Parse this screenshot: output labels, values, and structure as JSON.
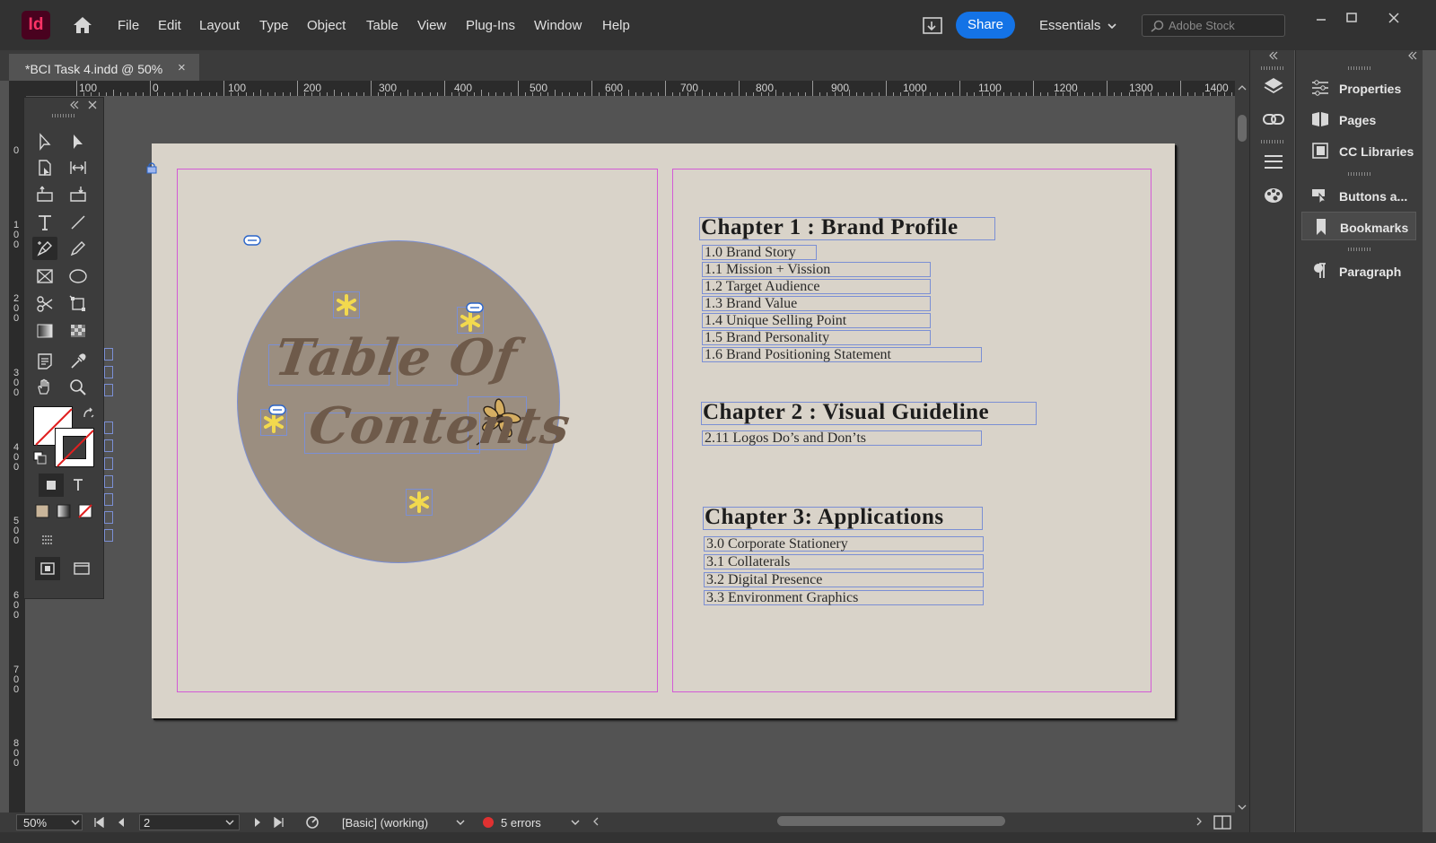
{
  "app": {
    "logo_text": "Id"
  },
  "menu": [
    "File",
    "Edit",
    "Layout",
    "Type",
    "Object",
    "Table",
    "View",
    "Plug-Ins",
    "Window",
    "Help"
  ],
  "toolbar": {
    "share_label": "Share",
    "workspace_label": "Essentials",
    "stock_placeholder": "Adobe Stock"
  },
  "document": {
    "tab_label": "*BCI Task 4.indd @ 50%",
    "tab_close": "×"
  },
  "ruler": {
    "h_labels": [
      "100",
      "0",
      "100",
      "200",
      "300",
      "400",
      "500",
      "600",
      "700",
      "800",
      "900",
      "1000",
      "1100",
      "1200",
      "1300",
      "1400"
    ],
    "v_labels": [
      "0",
      "100",
      "200",
      "300",
      "400",
      "500",
      "600",
      "700",
      "800"
    ]
  },
  "page": {
    "left": {
      "title_line1": "Table Of",
      "title_line2": "Contents"
    },
    "chapters": [
      {
        "title": "Chapter 1 : Brand Profile",
        "items": [
          "1.0 Brand Story",
          "1.1 Mission + Vission",
          "1.2 Target Audience",
          "1.3 Brand Value",
          "1.4 Unique Selling Point",
          "1.5 Brand Personality",
          "1.6 Brand Positioning Statement"
        ]
      },
      {
        "title": "Chapter 2 : Visual Guideline",
        "items": [
          "2.11 Logos Do’s and Don’ts"
        ]
      },
      {
        "title": "Chapter 3: Applications",
        "items": [
          "3.0 Corporate Stationery",
          "3.1 Collaterals",
          "3.2 Digital Presence",
          "3.3 Environment Graphics"
        ]
      }
    ]
  },
  "panels": [
    "Properties",
    "Pages",
    "CC Libraries",
    "Buttons a...",
    "Bookmarks",
    "Paragraph"
  ],
  "status": {
    "zoom": "50%",
    "page": "2",
    "preflight_profile": "[Basic] (working)",
    "errors": "5 errors"
  },
  "colors": {
    "accent": "#1473e6",
    "app_logo_bg": "#49021f",
    "app_logo_fg": "#ff3366",
    "page_bg": "#d9d3c9",
    "circle": "#9b8e80",
    "flower": "#f2d94e",
    "error": "#e03131"
  }
}
